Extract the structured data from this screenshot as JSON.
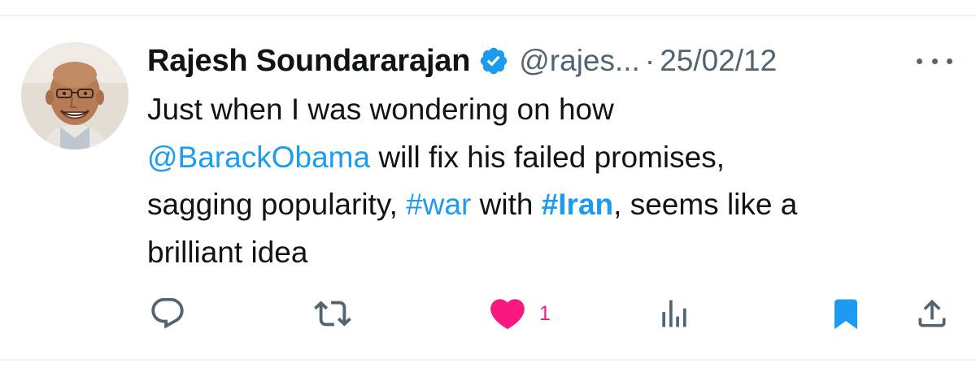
{
  "tweet": {
    "author_name": "Rajesh Soundararajan",
    "author_handle": "@rajes...",
    "separator": "·",
    "date": "25/02/12",
    "text": {
      "line1": "Just when I was wondering on how",
      "line2_mention": "@BarackObama",
      "line2_rest": " will fix his failed promises,",
      "line3_start": "sagging popularity, ",
      "line3_tag1": "#war",
      "line3_mid": " with ",
      "line3_tag2": "#Iran",
      "line3_end": ", seems like a",
      "line4": "brilliant idea"
    },
    "metrics": {
      "likes": "1"
    }
  },
  "icons": {
    "verified": "verified-badge-icon",
    "more": "more-dots-icon",
    "reply": "reply-icon",
    "retweet": "retweet-icon",
    "like": "heart-filled-icon",
    "views": "views-icon",
    "bookmark": "bookmark-filled-icon",
    "share": "share-icon"
  },
  "colors": {
    "link": "#1d9bf0",
    "like": "#f91880",
    "muted": "#536471",
    "text": "#0f1419",
    "divider": "#eff3f4"
  }
}
